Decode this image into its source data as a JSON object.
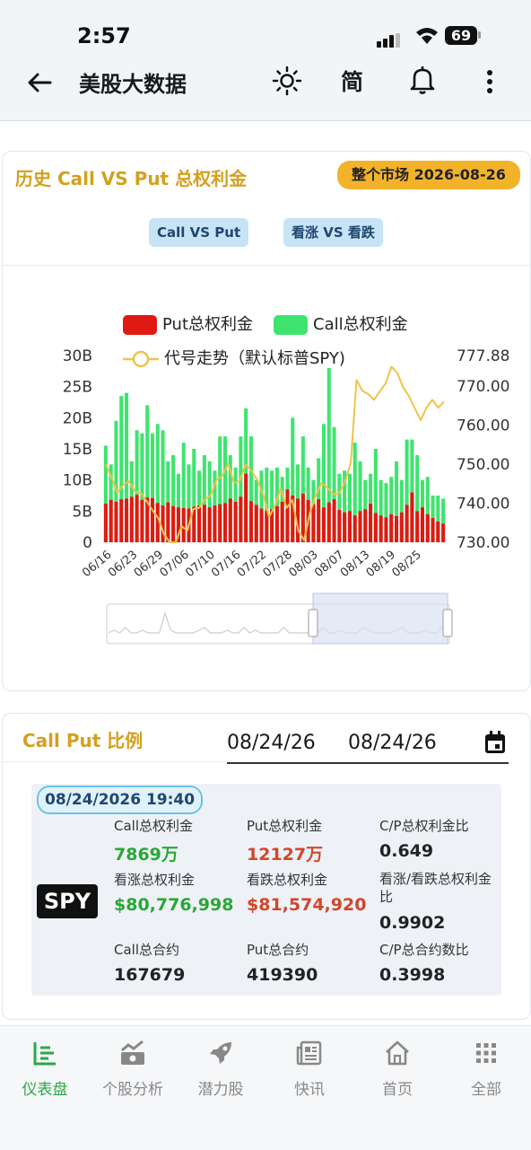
{
  "status": {
    "time": "2:57",
    "battery": "69"
  },
  "app_bar": {
    "title": "美股大数据",
    "lang": "简"
  },
  "card": {
    "title": "历史 Call VS Put 总权利金",
    "market_badge": "整个市场 2026-08-26",
    "tabs": [
      "Call VS Put",
      "看涨 VS 看跌"
    ]
  },
  "colors": {
    "put": "#e01a12",
    "call": "#3fe46f",
    "line": "#f0c24a",
    "accent": "#d4a020",
    "badge": "#f2b32a"
  },
  "chart_data": {
    "type": "bar",
    "legend": [
      "Put总权利金",
      "Call总权利金",
      "代号走势（默认标普SPY)"
    ],
    "x_tick_labels": [
      "06/16",
      "06/23",
      "06/29",
      "07/06",
      "07/10",
      "07/16",
      "07/22",
      "07/28",
      "08/03",
      "08/07",
      "08/13",
      "08/19",
      "08/25"
    ],
    "y_left_ticks": [
      "0",
      "5B",
      "10B",
      "15B",
      "20B",
      "25B",
      "30B"
    ],
    "y_right_ticks": [
      "730.00",
      "740.00",
      "750.00",
      "760.00",
      "770.00",
      "777.88"
    ],
    "ylim_left": [
      0,
      30
    ],
    "ylim_right": [
      730,
      777.88
    ],
    "series": [
      {
        "name": "Put总权利金",
        "values": [
          6.2,
          6.8,
          6.5,
          6.9,
          7.0,
          7.3,
          7.6,
          6.8,
          7.2,
          7.1,
          6.3,
          5.9,
          6.4,
          5.8,
          5.6,
          5.5,
          5.4,
          5.7,
          5.9,
          6.0,
          5.6,
          5.9,
          6.1,
          6.3,
          7.0,
          6.5,
          7.3,
          11.0,
          6.6,
          6.0,
          5.4,
          5.1,
          5.3,
          5.8,
          6.5,
          8.5,
          7.5,
          7.0,
          7.8,
          6.8,
          6.1,
          6.9,
          5.6,
          6.4,
          6.9,
          5.2,
          4.8,
          5.0,
          4.3,
          5.0,
          5.3,
          6.2,
          4.7,
          4.3,
          4.0,
          4.5,
          4.2,
          4.8,
          6.0,
          8.0,
          5.0,
          5.6,
          4.5,
          3.9,
          3.3,
          3.0
        ]
      },
      {
        "name": "Call总权利金",
        "values": [
          15.5,
          12.5,
          19.5,
          23.5,
          24.0,
          13.0,
          18.0,
          17.5,
          22.0,
          17.5,
          19.0,
          18.0,
          13.0,
          14.0,
          11.0,
          16.0,
          12.5,
          15.0,
          11.5,
          14.0,
          13.0,
          11.5,
          17.0,
          17.0,
          14.0,
          12.0,
          17.0,
          21.5,
          17.0,
          10.0,
          11.5,
          12.0,
          11.5,
          12.0,
          10.5,
          12.0,
          20.0,
          12.5,
          17.0,
          12.0,
          10.0,
          13.5,
          19.0,
          28.0,
          18.5,
          11.0,
          11.5,
          11.0,
          16.0,
          13.0,
          10.0,
          11.0,
          15.0,
          10.0,
          9.5,
          10.5,
          13.0,
          10.0,
          16.5,
          16.5,
          14.0,
          10.0,
          10.5,
          7.5,
          7.5,
          7.0
        ]
      },
      {
        "name": "代号走势（默认标普SPY)",
        "values": [
          750.0,
          746.5,
          742.7,
          744.7,
          745.6,
          743.0,
          742.6,
          740.6,
          738.2,
          736.2,
          732.0,
          730.0,
          730.0,
          734.1,
          733.0,
          738.5,
          738.8,
          741.0,
          742.0,
          746.0,
          747.0,
          750.1,
          745.2,
          745.8,
          750.0,
          748.3,
          746.0,
          742.2,
          736.5,
          739.2,
          743.8,
          738.8,
          740.8,
          733.0,
          730.5,
          737.5,
          742.0,
          745.2,
          744.0,
          742.3,
          742.5,
          745.4,
          750.2,
          771.6,
          768.8,
          768.0,
          766.5,
          768.7,
          770.8,
          775.0,
          773.4,
          769.7,
          767.4,
          764.3,
          761.3,
          764.5,
          766.5,
          764.5,
          766.0
        ]
      }
    ]
  },
  "ratio": {
    "title": "Call Put 比例",
    "date_start": "08/24/26",
    "date_end": "08/24/26",
    "timestamp": "08/24/2026 19:40",
    "ticker": "SPY",
    "rows": [
      [
        {
          "label": "Call总权利金",
          "value": "7869万"
        },
        {
          "label": "Put总权利金",
          "value": "12127万"
        },
        {
          "label": "C/P总权利金比",
          "value": "0.649"
        }
      ],
      [
        {
          "label": "看涨总权利金",
          "value": "$80,776,998"
        },
        {
          "label": "看跌总权利金",
          "value": "$81,574,920"
        },
        {
          "label": "看涨/看跌总权利金比",
          "value": "0.9902"
        }
      ],
      [
        {
          "label": "Call总合约",
          "value": "167679"
        },
        {
          "label": "Put总合约",
          "value": "419390"
        },
        {
          "label": "C/P总合约数比",
          "value": "0.3998"
        }
      ]
    ]
  },
  "nav": [
    {
      "label": "仪表盘",
      "icon": "dashboard-icon",
      "active": true
    },
    {
      "label": "个股分析",
      "icon": "stock-analysis-icon"
    },
    {
      "label": "潜力股",
      "icon": "rocket-icon"
    },
    {
      "label": "快讯",
      "icon": "news-icon"
    },
    {
      "label": "首页",
      "icon": "home-icon"
    },
    {
      "label": "全部",
      "icon": "grid-icon"
    }
  ]
}
